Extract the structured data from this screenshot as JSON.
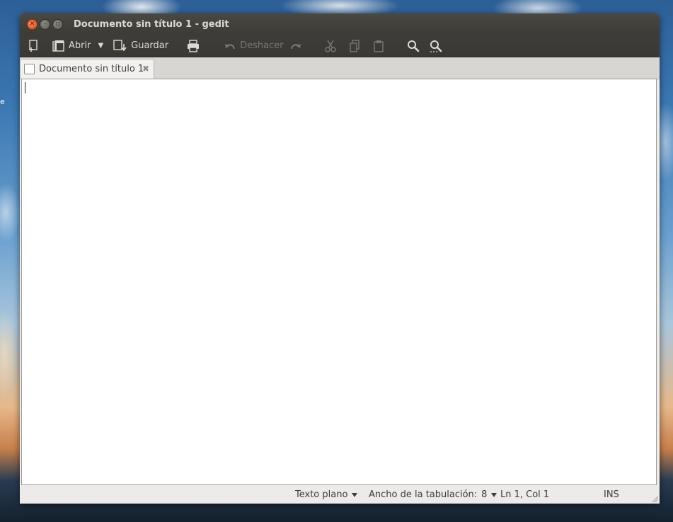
{
  "window": {
    "title": "Documento sin título 1 - gedit",
    "controls": [
      "close-icon",
      "minimize-icon",
      "maximize-icon"
    ]
  },
  "toolbar": {
    "new_icon": "new-document-icon",
    "open_label": "Abrir",
    "open_dropdown_icon": "chevron-down-icon",
    "save_label": "Guardar",
    "print_icon": "printer-icon",
    "undo_label": "Deshacer",
    "redo_icon": "redo-icon",
    "cut_icon": "scissors-icon",
    "copy_icon": "copy-icon",
    "paste_icon": "paste-icon",
    "find_icon": "search-icon",
    "replace_icon": "search-replace-icon"
  },
  "tabs": [
    {
      "label": "Documento sin título 1",
      "active": true
    }
  ],
  "editor": {
    "content": ""
  },
  "statusbar": {
    "language": "Texto plano",
    "tab_width_label": "Ancho de la tabulación:",
    "tab_width_value": "8",
    "cursor_position": "Ln 1, Col 1",
    "insert_mode": "INS"
  },
  "colors": {
    "titlebar": "#3d3b36",
    "close_button": "#e05420",
    "window_bg": "#edebe9"
  }
}
